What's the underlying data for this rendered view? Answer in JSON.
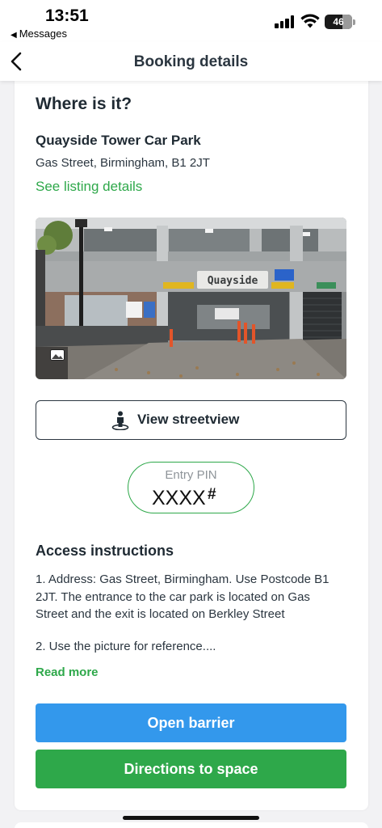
{
  "status_bar": {
    "time": "13:51",
    "back_app": "Messages",
    "battery": "46"
  },
  "nav": {
    "title": "Booking details",
    "back_icon": "chevron-left-icon"
  },
  "location": {
    "heading": "Where is it?",
    "name": "Quayside Tower Car Park",
    "address": "Gas Street, Birmingham, B1 2JT",
    "listing_link": "See listing details",
    "photo_sign_text": "Quayside"
  },
  "streetview": {
    "label": "View streetview",
    "icon": "person-pin-icon"
  },
  "entry_pin": {
    "label": "Entry PIN",
    "value": "XXXX",
    "suffix": "#"
  },
  "access": {
    "heading": "Access instructions",
    "text_1": "1. Address:  Gas Street, Birmingham. Use Postcode B1 2JT. The entrance to the car park is located on Gas Street and the exit is located on Berkley Street",
    "text_2": "2. Use the picture for reference....",
    "read_more": "Read more"
  },
  "actions": {
    "open_barrier": "Open barrier",
    "directions": "Directions to space"
  },
  "colors": {
    "green": "#2ea84a",
    "blue": "#3398ec",
    "text_dark": "#1f2a33"
  }
}
